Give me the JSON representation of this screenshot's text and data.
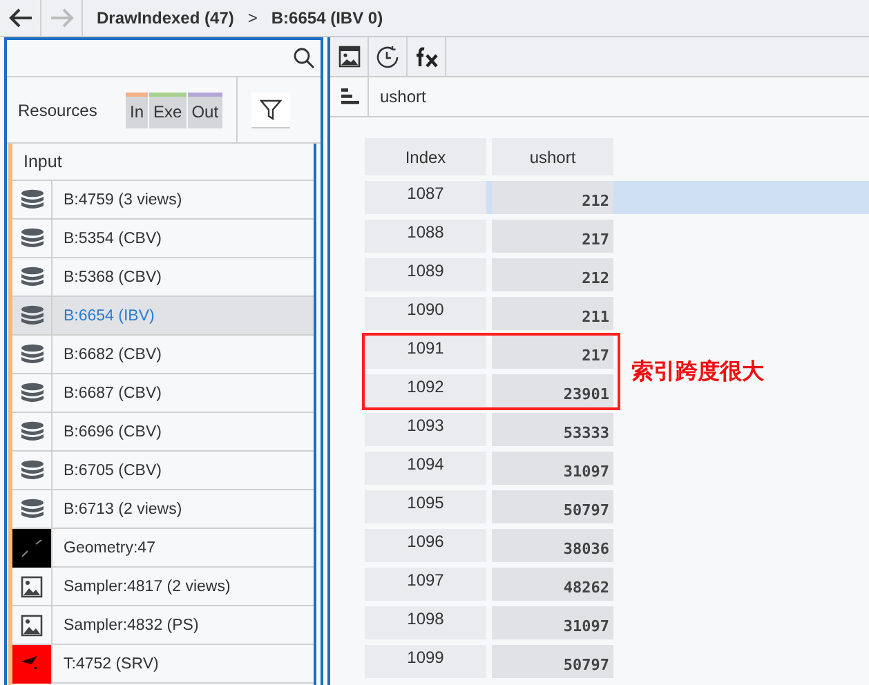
{
  "nav": {
    "back_disabled": false,
    "forward_disabled": true
  },
  "breadcrumb": [
    {
      "label": "DrawIndexed (47)"
    },
    {
      "label": ">"
    },
    {
      "label": "B:6654 (IBV 0)"
    }
  ],
  "resources": {
    "label": "Resources",
    "filters": [
      {
        "label": "In",
        "color": "#f4b183"
      },
      {
        "label": "Exe",
        "color": "#a9d18e"
      },
      {
        "label": "Out",
        "color": "#b4a7d6"
      }
    ]
  },
  "section": "Input",
  "items": [
    {
      "kind": "buffer",
      "label": "B:4759 (3 views)",
      "selected": false
    },
    {
      "kind": "buffer",
      "label": "B:5354 (CBV)",
      "selected": false
    },
    {
      "kind": "buffer",
      "label": "B:5368 (CBV)",
      "selected": false
    },
    {
      "kind": "buffer",
      "label": "B:6654 (IBV)",
      "selected": true
    },
    {
      "kind": "buffer",
      "label": "B:6682 (CBV)",
      "selected": false
    },
    {
      "kind": "buffer",
      "label": "B:6687 (CBV)",
      "selected": false
    },
    {
      "kind": "buffer",
      "label": "B:6696 (CBV)",
      "selected": false
    },
    {
      "kind": "buffer",
      "label": "B:6705 (CBV)",
      "selected": false
    },
    {
      "kind": "buffer",
      "label": "B:6713 (2 views)",
      "selected": false
    },
    {
      "kind": "geometry",
      "label": "Geometry:47",
      "selected": false
    },
    {
      "kind": "sampler",
      "label": "Sampler:4817 (2 views)",
      "selected": false
    },
    {
      "kind": "sampler",
      "label": "Sampler:4832 (PS)",
      "selected": false
    },
    {
      "kind": "texture",
      "label": "T:4752 (SRV)",
      "selected": false
    }
  ],
  "format": "ushort",
  "table": {
    "columns": [
      "Index",
      "ushort"
    ],
    "rows": [
      {
        "index": "1087",
        "value": "212",
        "selected": true
      },
      {
        "index": "1088",
        "value": "217",
        "selected": false
      },
      {
        "index": "1089",
        "value": "212",
        "selected": false
      },
      {
        "index": "1090",
        "value": "211",
        "selected": false
      },
      {
        "index": "1091",
        "value": "217",
        "selected": false,
        "annotated": true
      },
      {
        "index": "1092",
        "value": "23901",
        "selected": false,
        "annotated": true
      },
      {
        "index": "1093",
        "value": "53333",
        "selected": false
      },
      {
        "index": "1094",
        "value": "31097",
        "selected": false
      },
      {
        "index": "1095",
        "value": "50797",
        "selected": false
      },
      {
        "index": "1096",
        "value": "38036",
        "selected": false
      },
      {
        "index": "1097",
        "value": "48262",
        "selected": false
      },
      {
        "index": "1098",
        "value": "31097",
        "selected": false
      },
      {
        "index": "1099",
        "value": "50797",
        "selected": false
      }
    ]
  },
  "annotation": {
    "text": "索引跨度很大"
  }
}
